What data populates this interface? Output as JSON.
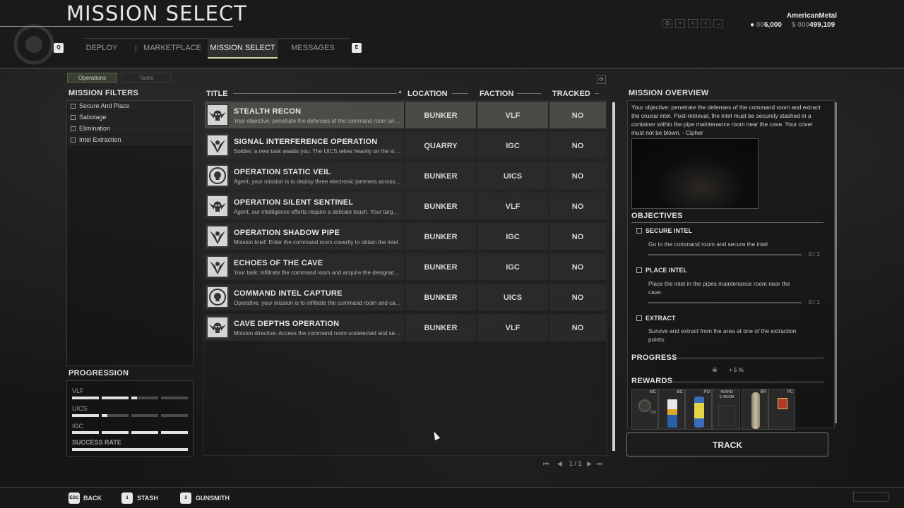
{
  "header": {
    "title": "MISSION SELECT",
    "nav_keys": {
      "left": "Q",
      "right": "E"
    },
    "tabs": [
      {
        "label": "DEPLOY",
        "active": false
      },
      {
        "label": "MARKETPLACE",
        "active": false
      },
      {
        "label": "MISSION SELECT",
        "active": true
      },
      {
        "label": "MESSAGES",
        "active": false
      }
    ],
    "username": "AmericanMetal",
    "currency_a_dim": "00",
    "currency_a": "6,000",
    "currency_b_dim": "$ 000",
    "currency_b": "499,109",
    "icons": [
      "settings-icon",
      "add-icon",
      "add-icon",
      "add-icon",
      "arrow-icon"
    ]
  },
  "subtabs": {
    "operations": "Operations",
    "tasks": "Tasks"
  },
  "filters": {
    "title": "MISSION FILTERS",
    "items": [
      "Secure And Place",
      "Sabotage",
      "Elimination",
      "Intel Extraction"
    ]
  },
  "progression": {
    "title": "PROGRESSION",
    "rows": [
      {
        "label": "VLF",
        "fraction": 0.55
      },
      {
        "label": "UICS",
        "fraction": 0.3
      },
      {
        "label": "IGC",
        "fraction": 1.0
      },
      {
        "label": "SUCCESS RATE",
        "fraction": 1.0
      }
    ]
  },
  "columns": {
    "title": "TITLE",
    "location": "LOCATION",
    "faction": "FACTION",
    "tracked": "TRACKED"
  },
  "missions": [
    {
      "title": "STEALTH RECON",
      "desc": "Your objective: penetrate the defenses of the command room and extract the crucial intel.",
      "location": "BUNKER",
      "faction": "VLF",
      "tracked": "NO",
      "icon": "skull-wings-icon"
    },
    {
      "title": "SIGNAL INTERFERENCE OPERATION",
      "desc": "Soldier, a new task awaits you. The UICS relies heavily on the signal network.",
      "location": "QUARRY",
      "faction": "IGC",
      "tracked": "NO",
      "icon": "eagle-icon"
    },
    {
      "title": "OPERATION STATIC VEIL",
      "desc": "Agent, your mission is to deploy three electronic jammers across the area.",
      "location": "BUNKER",
      "faction": "UICS",
      "tracked": "NO",
      "icon": "globe-skull-icon"
    },
    {
      "title": "OPERATION SILENT SENTINEL",
      "desc": "Agent, our intelligence efforts require a delicate touch. Your target is the intel.",
      "location": "BUNKER",
      "faction": "VLF",
      "tracked": "NO",
      "icon": "skull-wings-icon"
    },
    {
      "title": "OPERATION SHADOW PIPE",
      "desc": "Mission brief: Enter the command room covertly to obtain the intel.",
      "location": "BUNKER",
      "faction": "IGC",
      "tracked": "NO",
      "icon": "eagle-icon"
    },
    {
      "title": "ECHOES OF THE CAVE",
      "desc": "Your task: infiltrate the command room and acquire the designated intel.",
      "location": "BUNKER",
      "faction": "IGC",
      "tracked": "NO",
      "icon": "eagle-icon"
    },
    {
      "title": "COMMAND INTEL CAPTURE",
      "desc": "Operative, your mission is to infiltrate the command room and capture the intel.",
      "location": "BUNKER",
      "faction": "UICS",
      "tracked": "NO",
      "icon": "globe-skull-icon"
    },
    {
      "title": "CAVE DEPTHS OPERATION",
      "desc": "Mission directive: Access the command room undetected and secure the intel.",
      "location": "BUNKER",
      "faction": "VLF",
      "tracked": "NO",
      "icon": "skull-wings-icon"
    }
  ],
  "pager": {
    "page": "1 / 1"
  },
  "overview": {
    "title": "MISSION OVERVIEW",
    "text": "Your objective: penetrate the defenses of the command room and extract the crucial intel. Post-retrieval, the intel must be securely stashed in a container within the pipe maintenance room near the cave. Your cover must not be blown. - Cipher",
    "objectives_title": "OBJECTIVES",
    "objectives": [
      {
        "title": "SECURE INTEL",
        "desc": "Go to the command room and secure the intel.",
        "count": "0 / 1"
      },
      {
        "title": "PLACE INTEL",
        "desc": "Place the intel in the pipes maintenance room near the cave.",
        "count": "0 / 1"
      },
      {
        "title": "EXTRACT",
        "desc": "Survive and extract from the area at one of the extraction points.",
        "count": ""
      }
    ],
    "progress_title": "PROGRESS",
    "progress_value": "+ 5 %",
    "rewards_title": "REWARDS",
    "rewards": [
      {
        "label": "MC",
        "sub": "500"
      },
      {
        "label": "BC",
        "sub": ""
      },
      {
        "label": "PO",
        "sub": ""
      },
      {
        "label": "45RND 5.45X39",
        "sub": ""
      },
      {
        "label": "BR",
        "sub": ""
      },
      {
        "label": "PC",
        "sub": ""
      }
    ],
    "track_label": "TRACK"
  },
  "footer": {
    "items": [
      {
        "key": "ESC",
        "label": "BACK"
      },
      {
        "key": "1",
        "label": "STASH"
      },
      {
        "key": "3",
        "label": "GUNSMITH"
      }
    ]
  }
}
